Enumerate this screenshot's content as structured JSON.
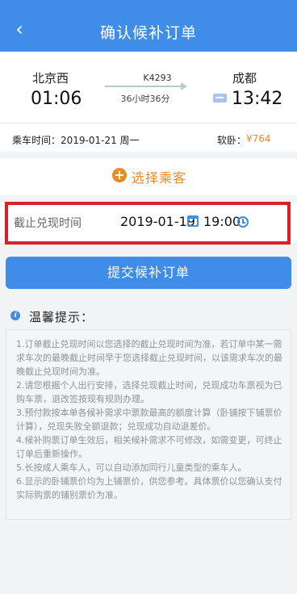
{
  "header": {
    "title": "确认候补订单"
  },
  "train": {
    "from_station": "北京西",
    "depart_time": "01:06",
    "train_no": "K4293",
    "duration": "36小时36分",
    "to_station": "成都",
    "arrive_time": "13:42"
  },
  "ride": {
    "date_text": "乘车时间：2019-01-21 周一",
    "seat_type": "软卧：",
    "price": "¥764"
  },
  "select_passenger": {
    "label": "选择乘客"
  },
  "deadline": {
    "label": "截止兑现时间",
    "date": "2019-01-19",
    "time": "19:00"
  },
  "submit": {
    "label": "提交候补订单"
  },
  "tips": {
    "title": "温馨提示：",
    "items": [
      "1.订单截止兑现时间以您选择的截止兑现时间为准，若订单中某一需求车次的最晚截止时间早于您选择截止兑现时间，以该需求车次的最晚截止兑现时间为准。",
      "2.请您根据个人出行安排，选择兑现截止时间，兑现成功车票视为已购车票，退改签按现有规则办理。",
      "3.预付款按本单各候补需求中票款最高的额度计算（卧铺按下铺票价计算），兑现失败全额退款；兑现成功自动退差价。",
      "4.候补购票订单生效后，相关候补需求不可修改，如需变更，可终止订单后重新操作。",
      "5.长按成人乘车人，可以自动添加同行儿童类型的乘车人。",
      "6.显示的卧铺票价均为上铺票价，供您参考。具体票价以您确认支付实际购票的铺别票价为准。"
    ]
  }
}
